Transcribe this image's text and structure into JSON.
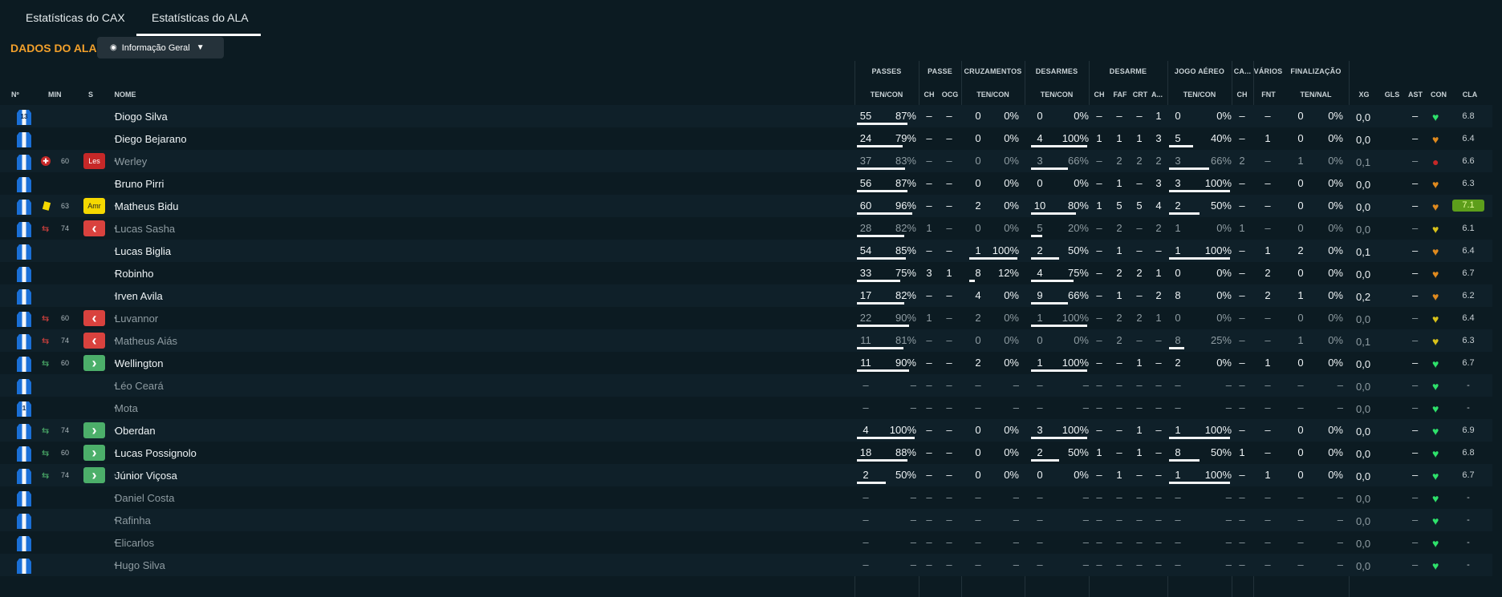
{
  "tabs": [
    {
      "label": "Estatísticas do CAX",
      "active": false
    },
    {
      "label": "Estatísticas do ALA",
      "active": true
    }
  ],
  "section_title": "DADOS DO ALA",
  "view_select": {
    "value": "Informação Geral",
    "icon": "eye-icon",
    "caret": "chevron-down-icon"
  },
  "group_headers": {
    "passes": "PASSES",
    "passe": "PASSE",
    "cruzamentos": "CRUZAMENTOS",
    "desarmes": "DESARMES",
    "desarme": "DESARME",
    "jogo_aereo": "JOGO AÉREO",
    "ca": "CA...",
    "varios": "VÁRIOS",
    "finalizacao": "FINALIZAÇÃO"
  },
  "columns": {
    "num": "Nº",
    "min": "MIN",
    "s": "S",
    "nome": "NOME",
    "passes": "TEN/CON",
    "passe_ch": "CH",
    "passe_ocg": "OCG",
    "cruz": "TEN/CON",
    "des": "TEN/CON",
    "d_ch": "CH",
    "d_faf": "FAF",
    "d_crt": "CRT",
    "d_a": "A...",
    "aer": "TEN/CON",
    "ca_ch": "CH",
    "fnt": "FNT",
    "fin": "TEN/NAL",
    "xg": "XG",
    "gls": "GLS",
    "ast": "AST",
    "con": "CON",
    "cla": "CLA"
  },
  "colors": {
    "accent": "#f2a02b",
    "background": "#0c1b22",
    "row_alt": "#0f2029",
    "injury": "#c62828",
    "yellow_card": "#f5d800",
    "sub_out": "#d9423e",
    "sub_in": "#4caf6a",
    "rating_best": "#5d9e1b"
  },
  "players": [
    {
      "kit": "13",
      "name": "Diogo Silva",
      "dim": false,
      "min": "",
      "event": "",
      "badge": "",
      "passes": [
        "55",
        "87%"
      ],
      "pbar": 0.87,
      "pch": "–",
      "pocg": "–",
      "cruz": [
        "0",
        "0%"
      ],
      "cbar": 0,
      "des": [
        "0",
        "0%"
      ],
      "dbar": 0,
      "dch": "–",
      "faf": "–",
      "crt": "–",
      "da": "1",
      "aer": [
        "0",
        "0%"
      ],
      "abar": 0,
      "cach": "–",
      "fnt": "–",
      "fin": [
        "0",
        "0%"
      ],
      "xg": "0,0",
      "ast": "–",
      "con": "green",
      "cla": "6.8"
    },
    {
      "kit": "",
      "name": "Diego Bejarano",
      "dim": false,
      "min": "",
      "event": "",
      "badge": "",
      "passes": [
        "24",
        "79%"
      ],
      "pbar": 0.79,
      "pch": "–",
      "pocg": "–",
      "cruz": [
        "0",
        "0%"
      ],
      "cbar": 0,
      "des": [
        "4",
        "100%"
      ],
      "dbar": 1,
      "dch": "1",
      "faf": "1",
      "crt": "1",
      "da": "3",
      "aer": [
        "5",
        "40%"
      ],
      "abar": 0.4,
      "cach": "–",
      "fnt": "1",
      "fin": [
        "0",
        "0%"
      ],
      "xg": "0,0",
      "ast": "–",
      "con": "orange",
      "cla": "6.4"
    },
    {
      "kit": "",
      "name": "Werley",
      "dim": true,
      "min": "60",
      "event": "injury",
      "badge": "Les",
      "passes": [
        "37",
        "83%"
      ],
      "pbar": 0.83,
      "pch": "–",
      "pocg": "–",
      "cruz": [
        "0",
        "0%"
      ],
      "cbar": 0,
      "des": [
        "3",
        "66%"
      ],
      "dbar": 0.66,
      "dch": "–",
      "faf": "2",
      "crt": "2",
      "da": "2",
      "aer": [
        "3",
        "66%"
      ],
      "abar": 0.66,
      "cach": "2",
      "fnt": "–",
      "fin": [
        "1",
        "0%"
      ],
      "xg": "0,1",
      "ast": "–",
      "con": "red",
      "cla": "6.6"
    },
    {
      "kit": "",
      "name": "Bruno Pirri",
      "dim": false,
      "min": "",
      "event": "",
      "badge": "",
      "passes": [
        "56",
        "87%"
      ],
      "pbar": 0.87,
      "pch": "–",
      "pocg": "–",
      "cruz": [
        "0",
        "0%"
      ],
      "cbar": 0,
      "des": [
        "0",
        "0%"
      ],
      "dbar": 0,
      "dch": "–",
      "faf": "1",
      "crt": "–",
      "da": "3",
      "aer": [
        "3",
        "100%"
      ],
      "abar": 1,
      "cach": "–",
      "fnt": "–",
      "fin": [
        "0",
        "0%"
      ],
      "xg": "0,0",
      "ast": "–",
      "con": "orange",
      "cla": "6.3"
    },
    {
      "kit": "",
      "name": "Matheus Bidu",
      "dim": false,
      "min": "63",
      "event": "yellow",
      "badge": "Amr",
      "passes": [
        "60",
        "96%"
      ],
      "pbar": 0.96,
      "pch": "–",
      "pocg": "–",
      "cruz": [
        "2",
        "0%"
      ],
      "cbar": 0,
      "des": [
        "10",
        "80%"
      ],
      "dbar": 0.8,
      "dch": "1",
      "faf": "5",
      "crt": "5",
      "da": "4",
      "aer": [
        "2",
        "50%"
      ],
      "abar": 0.5,
      "cach": "–",
      "fnt": "–",
      "fin": [
        "0",
        "0%"
      ],
      "xg": "0,0",
      "ast": "–",
      "con": "orange",
      "cla": "7.1",
      "best": true
    },
    {
      "kit": "",
      "name": "Lucas Sasha",
      "dim": true,
      "min": "74",
      "event": "sub_out",
      "badge": "out",
      "passes": [
        "28",
        "82%"
      ],
      "pbar": 0.82,
      "pch": "1",
      "pocg": "–",
      "cruz": [
        "0",
        "0%"
      ],
      "cbar": 0,
      "des": [
        "5",
        "20%"
      ],
      "dbar": 0.2,
      "dch": "–",
      "faf": "2",
      "crt": "–",
      "da": "2",
      "aer": [
        "1",
        "0%"
      ],
      "abar": 0,
      "cach": "1",
      "fnt": "–",
      "fin": [
        "0",
        "0%"
      ],
      "xg": "0,0",
      "ast": "–",
      "con": "yellow",
      "cla": "6.1"
    },
    {
      "kit": "",
      "name": "Lucas Biglia",
      "dim": false,
      "min": "",
      "event": "",
      "badge": "",
      "passes": [
        "54",
        "85%"
      ],
      "pbar": 0.85,
      "pch": "–",
      "pocg": "–",
      "cruz": [
        "1",
        "100%"
      ],
      "cbar": 1,
      "des": [
        "2",
        "50%"
      ],
      "dbar": 0.5,
      "dch": "–",
      "faf": "1",
      "crt": "–",
      "da": "–",
      "aer": [
        "1",
        "100%"
      ],
      "abar": 1,
      "cach": "–",
      "fnt": "1",
      "fin": [
        "2",
        "0%"
      ],
      "xg": "0,1",
      "ast": "–",
      "con": "orange",
      "cla": "6.4"
    },
    {
      "kit": "",
      "name": "Robinho",
      "dim": false,
      "min": "",
      "event": "",
      "badge": "",
      "passes": [
        "33",
        "75%"
      ],
      "pbar": 0.75,
      "pch": "3",
      "pocg": "1",
      "cruz": [
        "8",
        "12%"
      ],
      "cbar": 0.12,
      "des": [
        "4",
        "75%"
      ],
      "dbar": 0.75,
      "dch": "–",
      "faf": "2",
      "crt": "2",
      "da": "1",
      "aer": [
        "0",
        "0%"
      ],
      "abar": 0,
      "cach": "–",
      "fnt": "2",
      "fin": [
        "0",
        "0%"
      ],
      "xg": "0,0",
      "ast": "–",
      "con": "orange",
      "cla": "6.7"
    },
    {
      "kit": "",
      "name": "Irven Avila",
      "dim": false,
      "min": "",
      "event": "",
      "badge": "",
      "passes": [
        "17",
        "82%"
      ],
      "pbar": 0.82,
      "pch": "–",
      "pocg": "–",
      "cruz": [
        "4",
        "0%"
      ],
      "cbar": 0,
      "des": [
        "9",
        "66%"
      ],
      "dbar": 0.66,
      "dch": "–",
      "faf": "1",
      "crt": "–",
      "da": "2",
      "aer": [
        "8",
        "0%"
      ],
      "abar": 0,
      "cach": "–",
      "fnt": "2",
      "fin": [
        "1",
        "0%"
      ],
      "xg": "0,2",
      "ast": "–",
      "con": "orange",
      "cla": "6.2"
    },
    {
      "kit": "",
      "name": "Luvannor",
      "dim": true,
      "min": "60",
      "event": "sub_out",
      "badge": "out",
      "passes": [
        "22",
        "90%"
      ],
      "pbar": 0.9,
      "pch": "1",
      "pocg": "–",
      "cruz": [
        "2",
        "0%"
      ],
      "cbar": 0,
      "des": [
        "1",
        "100%"
      ],
      "dbar": 1,
      "dch": "–",
      "faf": "2",
      "crt": "2",
      "da": "1",
      "aer": [
        "0",
        "0%"
      ],
      "abar": 0,
      "cach": "–",
      "fnt": "–",
      "fin": [
        "0",
        "0%"
      ],
      "xg": "0,0",
      "ast": "–",
      "con": "yellow",
      "cla": "6.4"
    },
    {
      "kit": "",
      "name": "Matheus Aiás",
      "dim": true,
      "min": "74",
      "event": "sub_out",
      "badge": "out",
      "passes": [
        "11",
        "81%"
      ],
      "pbar": 0.81,
      "pch": "–",
      "pocg": "–",
      "cruz": [
        "0",
        "0%"
      ],
      "cbar": 0,
      "des": [
        "0",
        "0%"
      ],
      "dbar": 0,
      "dch": "–",
      "faf": "2",
      "crt": "–",
      "da": "–",
      "aer": [
        "8",
        "25%"
      ],
      "abar": 0.25,
      "cach": "–",
      "fnt": "–",
      "fin": [
        "1",
        "0%"
      ],
      "xg": "0,1",
      "ast": "–",
      "con": "yellow",
      "cla": "6.3"
    },
    {
      "kit": "",
      "name": "Wellington",
      "dim": false,
      "min": "60",
      "event": "sub_in",
      "badge": "in",
      "passes": [
        "11",
        "90%"
      ],
      "pbar": 0.9,
      "pch": "–",
      "pocg": "–",
      "cruz": [
        "2",
        "0%"
      ],
      "cbar": 0,
      "des": [
        "1",
        "100%"
      ],
      "dbar": 1,
      "dch": "–",
      "faf": "–",
      "crt": "1",
      "da": "–",
      "aer": [
        "2",
        "0%"
      ],
      "abar": 0,
      "cach": "–",
      "fnt": "1",
      "fin": [
        "0",
        "0%"
      ],
      "xg": "0,0",
      "ast": "–",
      "con": "green",
      "cla": "6.7"
    },
    {
      "kit": "",
      "name": "Léo Ceará",
      "dim": true,
      "min": "",
      "event": "",
      "badge": "",
      "passes": [
        "–",
        "–"
      ],
      "pbar": 0,
      "pch": "–",
      "pocg": "–",
      "cruz": [
        "–",
        "–"
      ],
      "cbar": 0,
      "des": [
        "–",
        "–"
      ],
      "dbar": 0,
      "dch": "–",
      "faf": "–",
      "crt": "–",
      "da": "–",
      "aer": [
        "–",
        "–"
      ],
      "abar": 0,
      "cach": "–",
      "fnt": "–",
      "fin": [
        "–",
        "–"
      ],
      "xg": "0,0",
      "ast": "–",
      "con": "green",
      "cla": "-"
    },
    {
      "kit": "1",
      "name": "Mota",
      "dim": true,
      "min": "",
      "event": "",
      "badge": "",
      "passes": [
        "–",
        "–"
      ],
      "pbar": 0,
      "pch": "–",
      "pocg": "–",
      "cruz": [
        "–",
        "–"
      ],
      "cbar": 0,
      "des": [
        "–",
        "–"
      ],
      "dbar": 0,
      "dch": "–",
      "faf": "–",
      "crt": "–",
      "da": "–",
      "aer": [
        "–",
        "–"
      ],
      "abar": 0,
      "cach": "–",
      "fnt": "–",
      "fin": [
        "–",
        "–"
      ],
      "xg": "0,0",
      "ast": "–",
      "con": "green",
      "cla": "-"
    },
    {
      "kit": "",
      "name": "Oberdan",
      "dim": false,
      "min": "74",
      "event": "sub_in",
      "badge": "in",
      "passes": [
        "4",
        "100%"
      ],
      "pbar": 1,
      "pch": "–",
      "pocg": "–",
      "cruz": [
        "0",
        "0%"
      ],
      "cbar": 0,
      "des": [
        "3",
        "100%"
      ],
      "dbar": 1,
      "dch": "–",
      "faf": "–",
      "crt": "1",
      "da": "–",
      "aer": [
        "1",
        "100%"
      ],
      "abar": 1,
      "cach": "–",
      "fnt": "–",
      "fin": [
        "0",
        "0%"
      ],
      "xg": "0,0",
      "ast": "–",
      "con": "green",
      "cla": "6.9"
    },
    {
      "kit": "",
      "name": "Lucas Possignolo",
      "dim": false,
      "min": "60",
      "event": "sub_in",
      "badge": "in",
      "passes": [
        "18",
        "88%"
      ],
      "pbar": 0.88,
      "pch": "–",
      "pocg": "–",
      "cruz": [
        "0",
        "0%"
      ],
      "cbar": 0,
      "des": [
        "2",
        "50%"
      ],
      "dbar": 0.5,
      "dch": "1",
      "faf": "–",
      "crt": "1",
      "da": "–",
      "aer": [
        "8",
        "50%"
      ],
      "abar": 0.5,
      "cach": "1",
      "fnt": "–",
      "fin": [
        "0",
        "0%"
      ],
      "xg": "0,0",
      "ast": "–",
      "con": "green",
      "cla": "6.8"
    },
    {
      "kit": "",
      "name": "Júnior Viçosa",
      "dim": false,
      "min": "74",
      "event": "sub_in",
      "badge": "in",
      "passes": [
        "2",
        "50%"
      ],
      "pbar": 0.5,
      "pch": "–",
      "pocg": "–",
      "cruz": [
        "0",
        "0%"
      ],
      "cbar": 0,
      "des": [
        "0",
        "0%"
      ],
      "dbar": 0,
      "dch": "–",
      "faf": "1",
      "crt": "–",
      "da": "–",
      "aer": [
        "1",
        "100%"
      ],
      "abar": 1,
      "cach": "–",
      "fnt": "1",
      "fin": [
        "0",
        "0%"
      ],
      "xg": "0,0",
      "ast": "–",
      "con": "green",
      "cla": "6.7"
    },
    {
      "kit": "",
      "name": "Daniel Costa",
      "dim": true,
      "min": "",
      "event": "",
      "badge": "",
      "passes": [
        "–",
        "–"
      ],
      "pbar": 0,
      "pch": "–",
      "pocg": "–",
      "cruz": [
        "–",
        "–"
      ],
      "cbar": 0,
      "des": [
        "–",
        "–"
      ],
      "dbar": 0,
      "dch": "–",
      "faf": "–",
      "crt": "–",
      "da": "–",
      "aer": [
        "–",
        "–"
      ],
      "abar": 0,
      "cach": "–",
      "fnt": "–",
      "fin": [
        "–",
        "–"
      ],
      "xg": "0,0",
      "ast": "–",
      "con": "green",
      "cla": "-"
    },
    {
      "kit": "",
      "name": "Rafinha",
      "dim": true,
      "min": "",
      "event": "",
      "badge": "",
      "passes": [
        "–",
        "–"
      ],
      "pbar": 0,
      "pch": "–",
      "pocg": "–",
      "cruz": [
        "–",
        "–"
      ],
      "cbar": 0,
      "des": [
        "–",
        "–"
      ],
      "dbar": 0,
      "dch": "–",
      "faf": "–",
      "crt": "–",
      "da": "–",
      "aer": [
        "–",
        "–"
      ],
      "abar": 0,
      "cach": "–",
      "fnt": "–",
      "fin": [
        "–",
        "–"
      ],
      "xg": "0,0",
      "ast": "–",
      "con": "green",
      "cla": "-"
    },
    {
      "kit": "",
      "name": "Elicarlos",
      "dim": true,
      "min": "",
      "event": "",
      "badge": "",
      "passes": [
        "–",
        "–"
      ],
      "pbar": 0,
      "pch": "–",
      "pocg": "–",
      "cruz": [
        "–",
        "–"
      ],
      "cbar": 0,
      "des": [
        "–",
        "–"
      ],
      "dbar": 0,
      "dch": "–",
      "faf": "–",
      "crt": "–",
      "da": "–",
      "aer": [
        "–",
        "–"
      ],
      "abar": 0,
      "cach": "–",
      "fnt": "–",
      "fin": [
        "–",
        "–"
      ],
      "xg": "0,0",
      "ast": "–",
      "con": "green",
      "cla": "-"
    },
    {
      "kit": "",
      "name": "Hugo Silva",
      "dim": true,
      "min": "",
      "event": "",
      "badge": "",
      "passes": [
        "–",
        "–"
      ],
      "pbar": 0,
      "pch": "–",
      "pocg": "–",
      "cruz": [
        "–",
        "–"
      ],
      "cbar": 0,
      "des": [
        "–",
        "–"
      ],
      "dbar": 0,
      "dch": "–",
      "faf": "–",
      "crt": "–",
      "da": "–",
      "aer": [
        "–",
        "–"
      ],
      "abar": 0,
      "cach": "–",
      "fnt": "–",
      "fin": [
        "–",
        "–"
      ],
      "xg": "0,0",
      "ast": "–",
      "con": "green",
      "cla": "-"
    }
  ]
}
